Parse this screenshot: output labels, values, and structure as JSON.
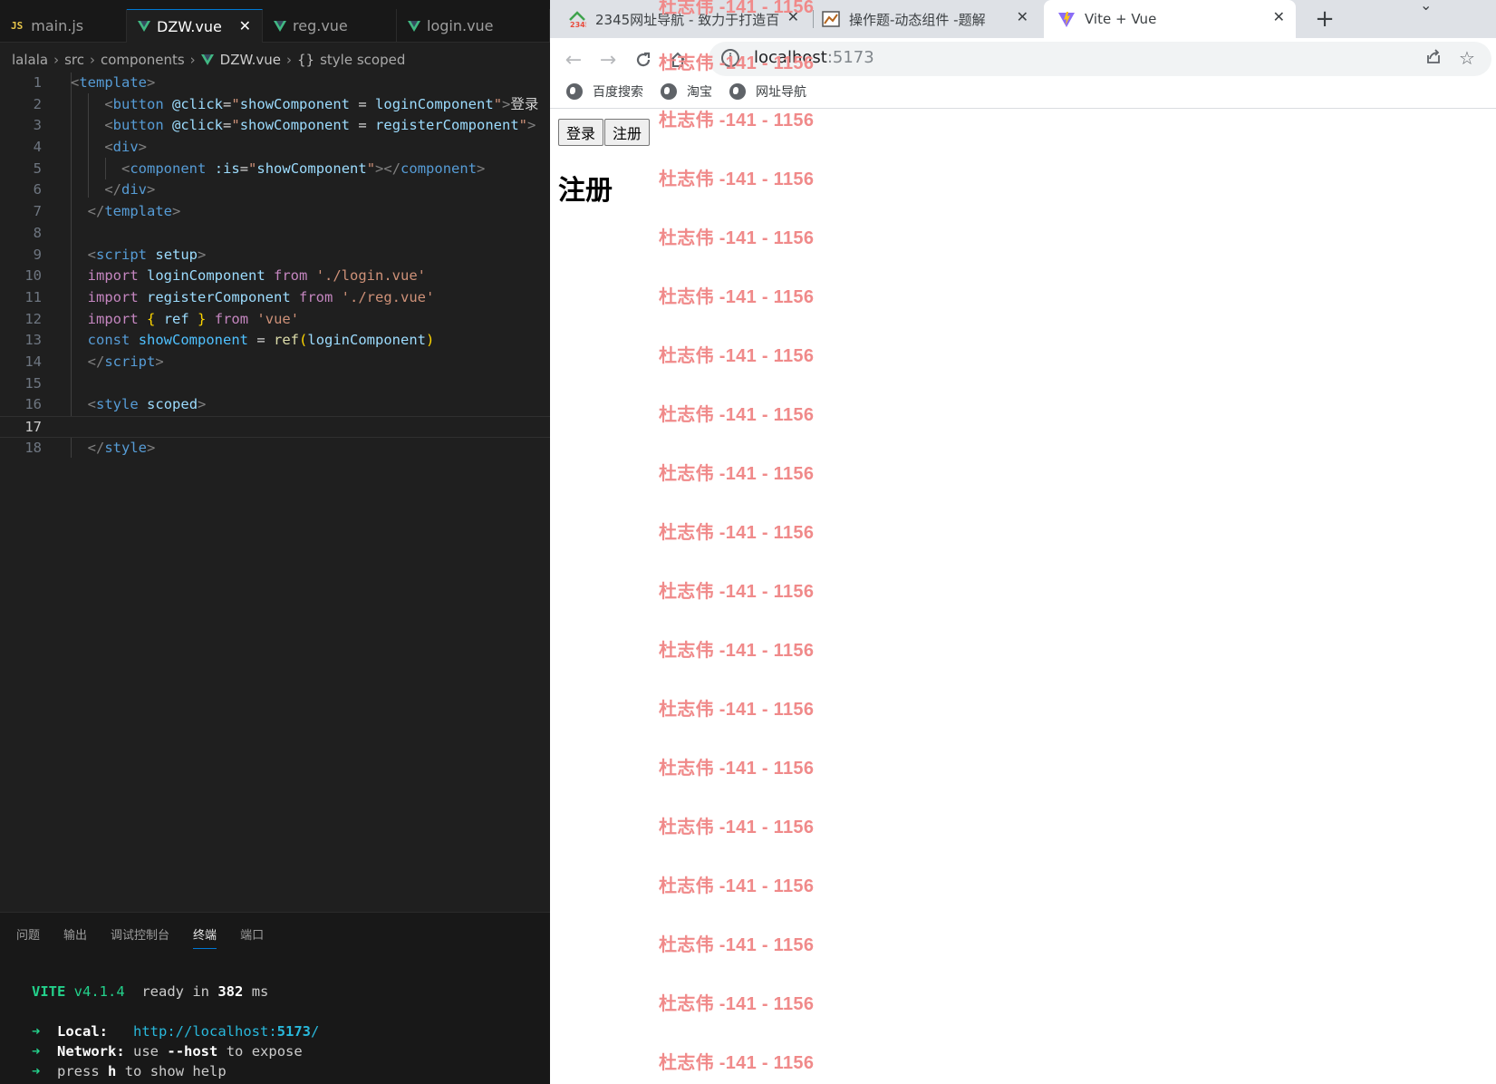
{
  "editor": {
    "tabs": [
      {
        "label": "main.js",
        "icon": "js-file-icon"
      },
      {
        "label": "DZW.vue",
        "icon": "vue-file-icon",
        "active": true
      },
      {
        "label": "reg.vue",
        "icon": "vue-file-icon"
      },
      {
        "label": "login.vue",
        "icon": "vue-file-icon"
      }
    ],
    "breadcrumb": {
      "root": "lalala",
      "src": "src",
      "components": "components",
      "file": "DZW.vue",
      "symbol_icon": "{}",
      "symbol": "style scoped"
    },
    "line_numbers": [
      "1",
      "2",
      "3",
      "4",
      "5",
      "6",
      "7",
      "8",
      "9",
      "10",
      "11",
      "12",
      "13",
      "14",
      "15",
      "16",
      "17",
      "18"
    ],
    "current_line": "17"
  },
  "panel": {
    "tabs": [
      "问题",
      "输出",
      "调试控制台",
      "终端",
      "端口"
    ],
    "active_tab": "终端",
    "terminal": {
      "vite": "VITE",
      "version": "v4.1.4",
      "ready_prefix": "ready in",
      "ready_ms": "382",
      "ms": "ms",
      "arrow": "➜",
      "local_label": "Local:",
      "local_url_base": "http://localhost:",
      "local_port": "5173",
      "local_slash": "/",
      "network_label": "Network:",
      "network_use": "use",
      "network_flag": "--host",
      "network_rest": "to expose",
      "press": "press",
      "press_key": "h",
      "press_rest": "to show help"
    }
  },
  "browser": {
    "tabs": [
      {
        "title": "2345网址导航 - 致力于打造百",
        "icon": "2345-logo-icon"
      },
      {
        "title": "操作题-动态组件 -题解",
        "icon": "page-thumbnail-icon"
      },
      {
        "title": "Vite + Vue",
        "icon": "vite-logo-icon",
        "active": true
      }
    ],
    "new_tab": "+",
    "url_host": "localhost",
    "url_port": ":5173",
    "bookmarks": [
      "百度搜索",
      "淘宝",
      "网址导航"
    ],
    "page": {
      "buttons": [
        "登录",
        "注册"
      ],
      "heading": "注册"
    },
    "watermark": "杜志伟 -141 - 1156"
  }
}
